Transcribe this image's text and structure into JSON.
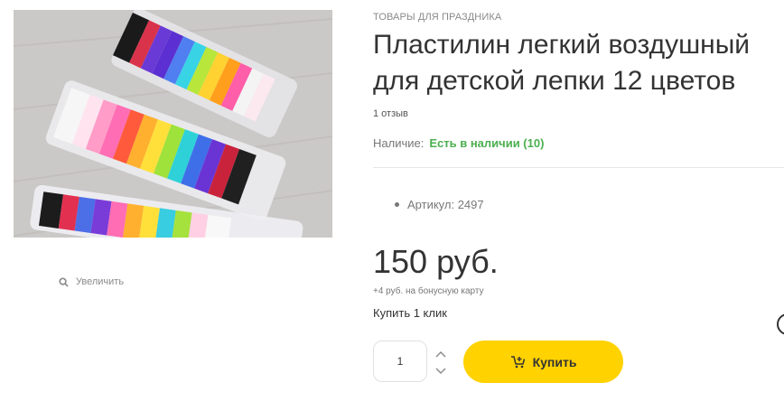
{
  "product": {
    "category": "ТОВАРЫ ДЛЯ ПРАЗДНИКА",
    "title_line1": "Пластилин легкий воздушный",
    "title_line2": "для детской лепки 12 цветов",
    "reviews": "1 отзыв",
    "stock_label": "Наличие:",
    "stock_value": "Есть в наличии (10)",
    "sku": "Артикул: 2497",
    "price": "150 руб.",
    "bonus": "+4 руб. на бонусную карту",
    "one_click": "Купить 1 клик",
    "quantity": "1",
    "buy_label": "Купить"
  },
  "gallery": {
    "zoom_label": "Увеличить"
  },
  "colors": {
    "accent": "#ffd200",
    "in_stock": "#4caf50"
  },
  "icons": {
    "zoom": "search-icon",
    "buy": "cart-plus-icon",
    "up": "chevron-up-icon",
    "down": "chevron-down-icon"
  }
}
